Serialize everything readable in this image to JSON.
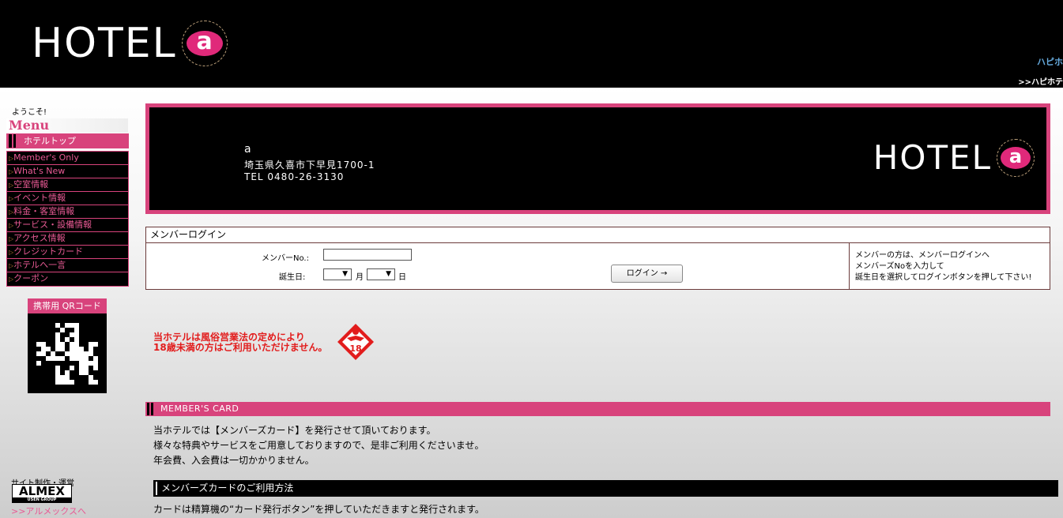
{
  "header": {
    "logo_text": "HOTEL",
    "logo_mark": "a",
    "link_top": "ハピホ",
    "link_bottom": ">>ハピホテ"
  },
  "sidebar": {
    "welcome": "ようこそ!",
    "menu_title": "Menu",
    "top_item": "ホテルトップ",
    "items": [
      {
        "label": "Member's Only"
      },
      {
        "label": "What's New"
      },
      {
        "label": "空室情報"
      },
      {
        "label": "イベント情報"
      },
      {
        "label": "料金・客室情報"
      },
      {
        "label": "サービス・設備情報"
      },
      {
        "label": "アクセス情報"
      },
      {
        "label": "クレジットカード"
      },
      {
        "label": "ホテルへ一言"
      },
      {
        "label": "クーポン"
      }
    ],
    "qr_label": "携帯用 QRコード",
    "credit": "サイト制作・運営",
    "almex_logo": "ALMEX",
    "almex_sub": "USEN GROUP",
    "almex_link": ">>アルメックスへ"
  },
  "banner": {
    "name": "a",
    "address": "埼玉県久喜市下早見1700-1",
    "tel": "TEL 0480-26-3130",
    "logo_text": "HOTEL",
    "logo_mark": "a"
  },
  "login": {
    "heading": "メンバーログイン",
    "member_no_label": "メンバーNo.:",
    "member_no_value": "",
    "birthday_label": "誕生日:",
    "month_label": "月",
    "day_label": "日",
    "month_value": "",
    "day_value": "",
    "button": "ログイン →",
    "note_1": "メンバーの方は、メンバーログインへ",
    "note_2": "メンバーズNoを入力して",
    "note_3": "誕生日を選択してログインボタンを押して下さい!"
  },
  "age_notice": {
    "line1": "当ホテルは風俗営業法の定めにより",
    "line2": "18歳未満の方はご利用いただけません。",
    "badge": "18"
  },
  "members_card": {
    "title": "MEMBER'S CARD",
    "line1": "当ホテルでは【メンバーズカード】を発行させて頂いております。",
    "line2": "様々な特典やサービスをご用意しておりますので、是非ご利用くださいませ。",
    "line3": "年会費、入会費は一切かかりません。",
    "usage_title": "メンバーズカードのご利用方法",
    "usage_text": "カードは精算機の“カード発行ボタン”を押していただきますと発行されます。"
  },
  "colors": {
    "accent": "#d8437c",
    "header_bg": "#000000",
    "warning": "#e21c1c"
  }
}
